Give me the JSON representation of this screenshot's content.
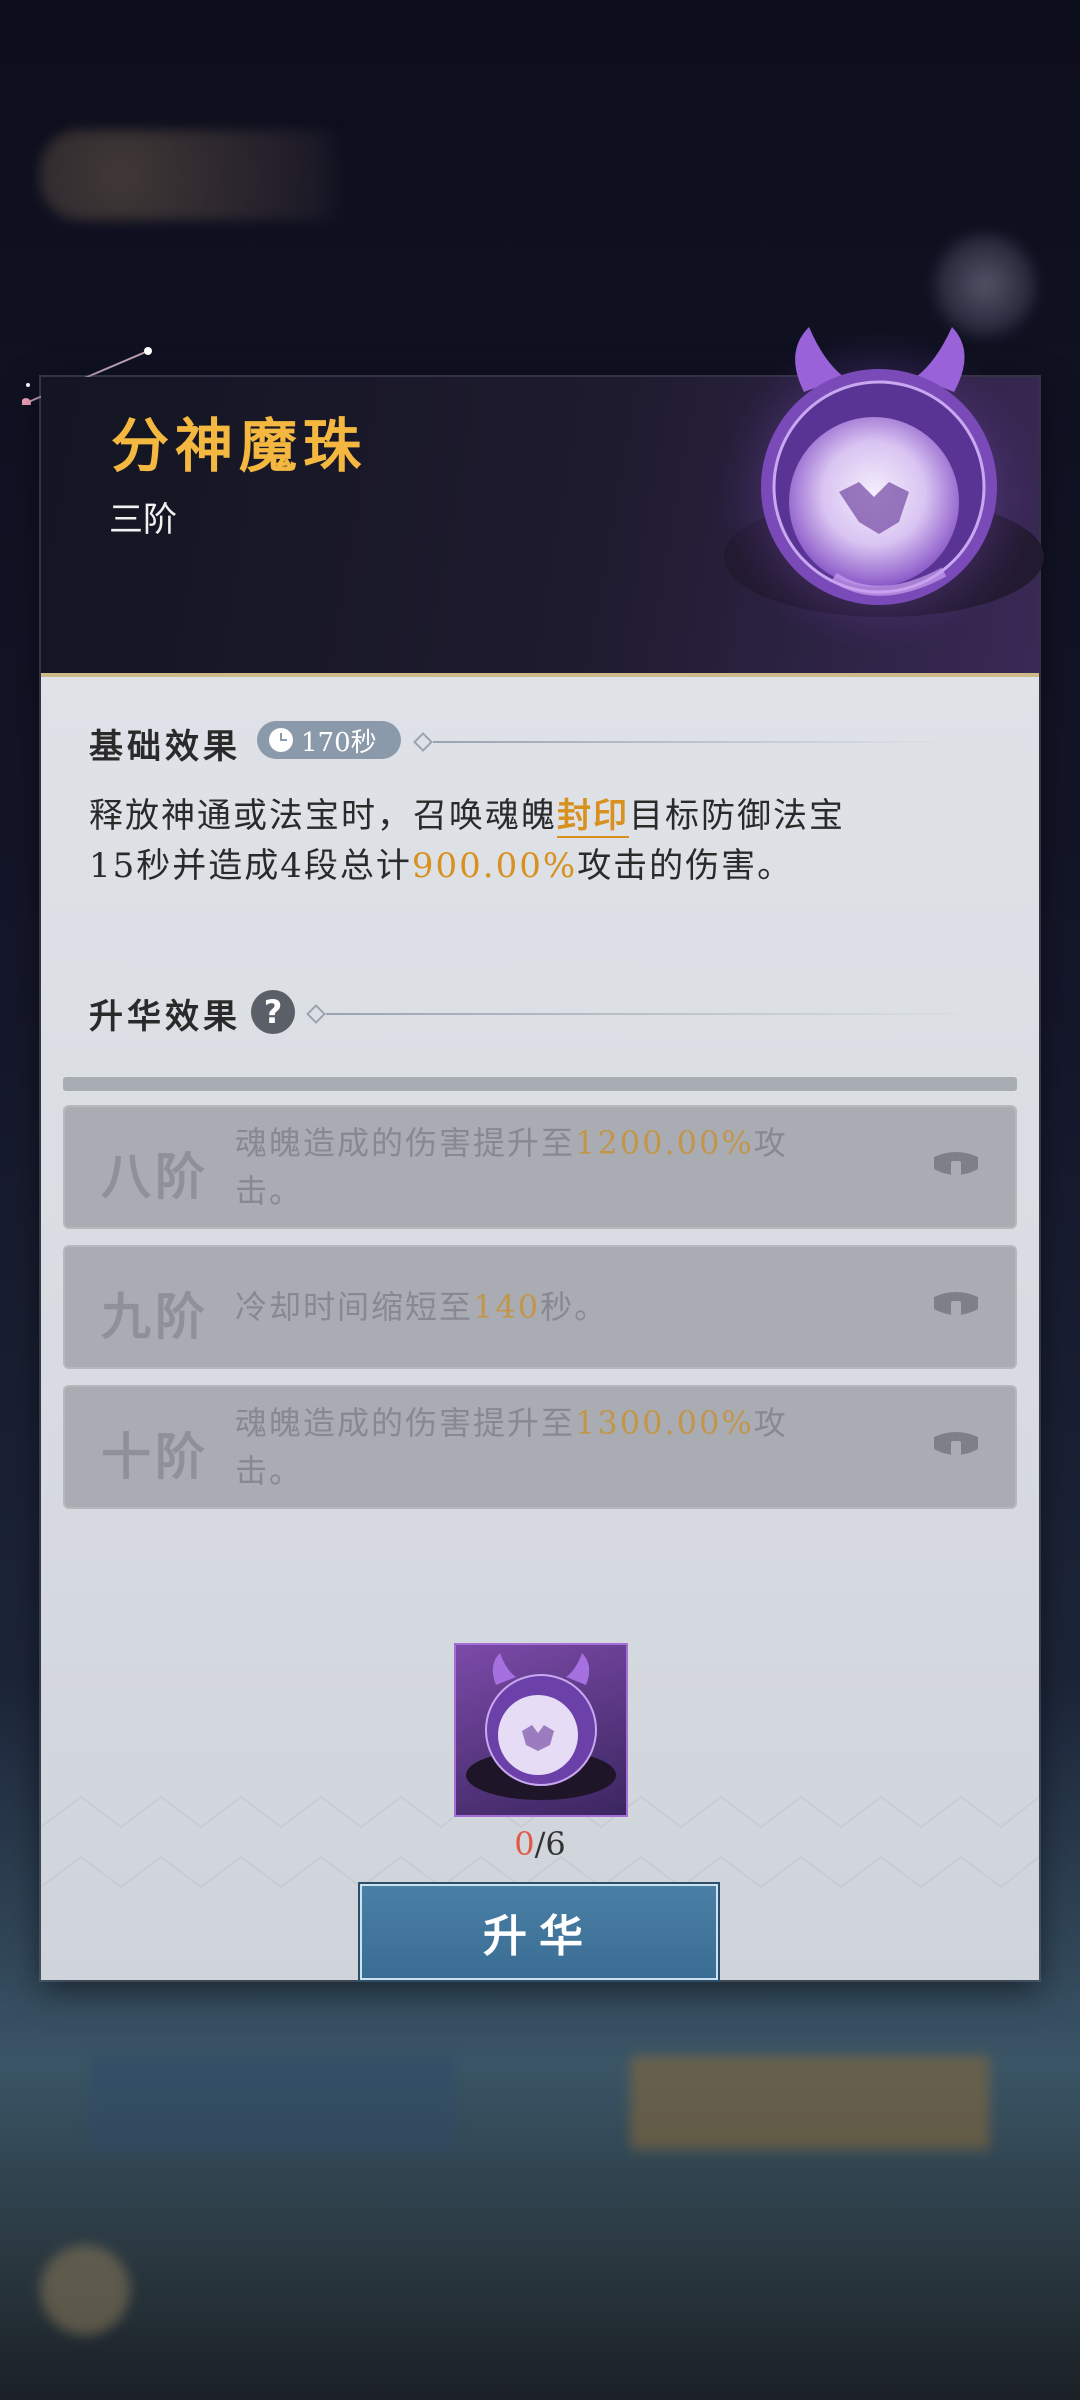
{
  "item": {
    "name": "分神魔珠",
    "tier": "三阶"
  },
  "base_effect": {
    "title": "基础效果",
    "cooldown": "170秒",
    "desc_parts": {
      "p1": "释放神通或法宝时，召唤魂魄",
      "link": "封印",
      "p2": "目标防御法宝",
      "p3": "15秒并造成4段总计",
      "value": "900.00%",
      "p4": "攻击的伤害。"
    }
  },
  "sublimation": {
    "title": "升华效果",
    "help": "?",
    "tiers": [
      {
        "label": "八阶",
        "text_a": "魂魄造成的伤害提升至",
        "value": "1200.00%",
        "text_b": "攻击。"
      },
      {
        "label": "九阶",
        "text_a": "冷却时间缩短至",
        "value": "140",
        "text_b": "秒。"
      },
      {
        "label": "十阶",
        "text_a": "魂魄造成的伤害提升至",
        "value": "1300.00%",
        "text_b": "攻击。"
      }
    ]
  },
  "material": {
    "have": "0",
    "need": "/6"
  },
  "upgrade_button": "升华",
  "colors": {
    "accent_gold": "#f4b840",
    "highlight": "#d8901e",
    "button": "#4a7fa6",
    "count_red": "#e05a4a"
  },
  "icons": [
    "clock-icon",
    "help-icon",
    "lock-icon",
    "demon-orb-icon"
  ]
}
